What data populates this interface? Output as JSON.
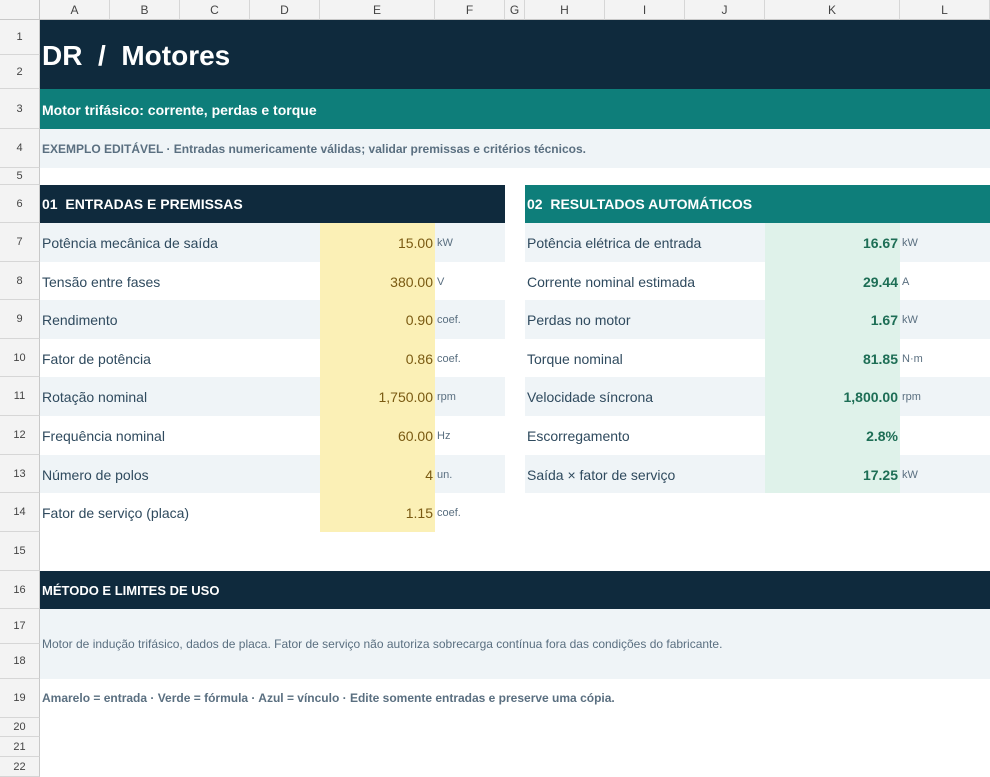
{
  "columns": [
    "A",
    "B",
    "C",
    "D",
    "E",
    "F",
    "G",
    "H",
    "I",
    "J",
    "K",
    "L"
  ],
  "rows": [
    "1",
    "2",
    "3",
    "4",
    "5",
    "6",
    "7",
    "8",
    "9",
    "10",
    "11",
    "12",
    "13",
    "14",
    "15",
    "16",
    "17",
    "18",
    "19",
    "20",
    "21",
    "22"
  ],
  "title": "DR  /  Motores",
  "subtitle": "Motor trifásico: corrente, perdas e torque",
  "note": "EXEMPLO EDITÁVEL · Entradas numericamente válidas; validar premissas e critérios técnicos.",
  "inputs": {
    "header": "01  ENTRADAS E PREMISSAS",
    "items": [
      {
        "label": "Potência mecânica de saída",
        "value": "15.00",
        "unit": "kW"
      },
      {
        "label": "Tensão entre fases",
        "value": "380.00",
        "unit": "V"
      },
      {
        "label": "Rendimento",
        "value": "0.90",
        "unit": "coef."
      },
      {
        "label": "Fator de potência",
        "value": "0.86",
        "unit": "coef."
      },
      {
        "label": "Rotação nominal",
        "value": "1,750.00",
        "unit": "rpm"
      },
      {
        "label": "Frequência nominal",
        "value": "60.00",
        "unit": "Hz"
      },
      {
        "label": "Número de polos",
        "value": "4",
        "unit": "un."
      },
      {
        "label": "Fator de serviço (placa)",
        "value": "1.15",
        "unit": "coef."
      }
    ]
  },
  "results": {
    "header": "02  RESULTADOS AUTOMÁTICOS",
    "items": [
      {
        "label": "Potência elétrica de entrada",
        "value": "16.67",
        "unit": "kW"
      },
      {
        "label": "Corrente nominal estimada",
        "value": "29.44",
        "unit": "A"
      },
      {
        "label": "Perdas no motor",
        "value": "1.67",
        "unit": "kW"
      },
      {
        "label": "Torque nominal",
        "value": "81.85",
        "unit": "N·m"
      },
      {
        "label": "Velocidade síncrona",
        "value": "1,800.00",
        "unit": "rpm"
      },
      {
        "label": "Escorregamento",
        "value": "2.8%",
        "unit": ""
      },
      {
        "label": "Saída × fator de serviço",
        "value": "17.25",
        "unit": "kW"
      }
    ]
  },
  "method": {
    "header": "MÉTODO E LIMITES DE USO",
    "text": "Motor de indução trifásico, dados de placa. Fator de serviço não autoriza sobrecarga contínua fora das condições do fabricante."
  },
  "legend": "Amarelo = entrada · Verde = fórmula · Azul = vínculo · Edite somente entradas e preserve uma cópia.",
  "colors": {
    "dark_navy": "#0f2a3d",
    "teal": "#0e7e7a",
    "input_fill": "#fbf0b6",
    "input_text": "#7a5a12",
    "result_fill": "#dff2ea",
    "result_text": "#1d6e55",
    "band_fill": "#eff4f7",
    "muted_text": "#5a6f80"
  }
}
